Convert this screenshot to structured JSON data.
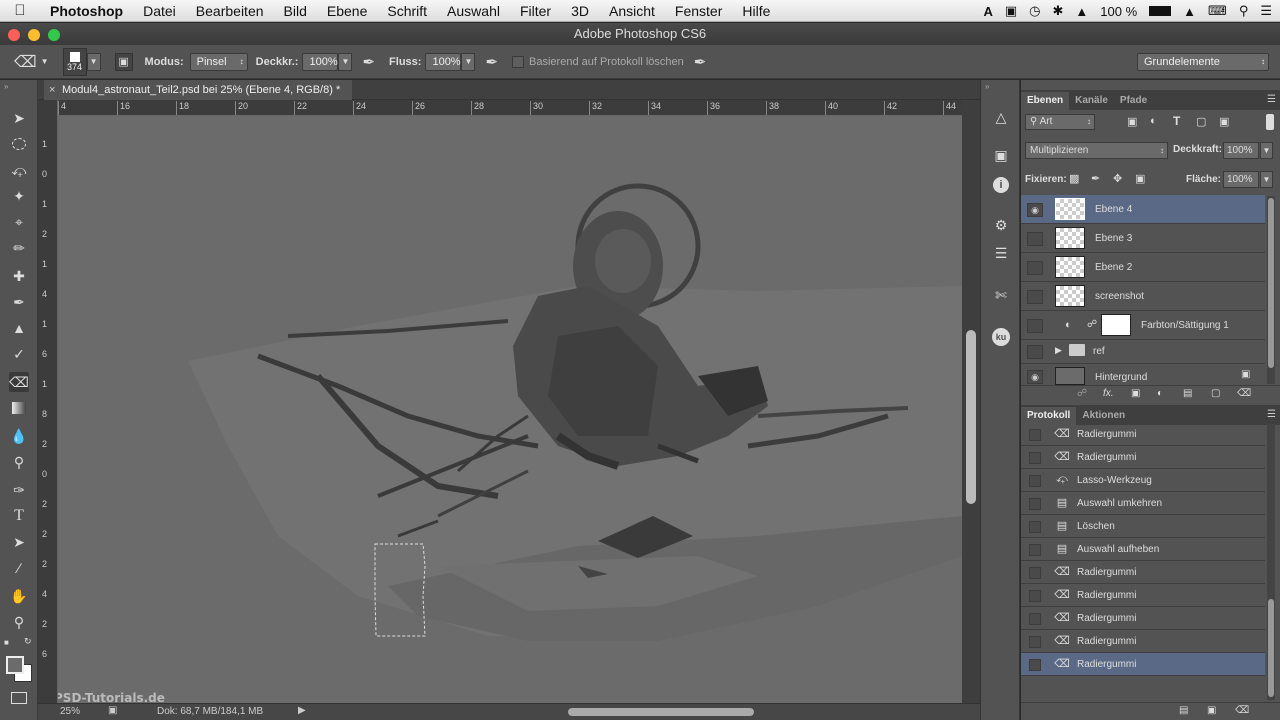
{
  "menubar": {
    "app": "Photoshop",
    "items": [
      "Datei",
      "Bearbeiten",
      "Bild",
      "Ebene",
      "Schrift",
      "Auswahl",
      "Filter",
      "3D",
      "Ansicht",
      "Fenster",
      "Hilfe"
    ],
    "battery": "100 %"
  },
  "window": {
    "title": "Adobe Photoshop CS6"
  },
  "options": {
    "brush_size": "374",
    "mode_label": "Modus:",
    "mode_value": "Pinsel",
    "opacity_label": "Deckkr.:",
    "opacity_value": "100%",
    "flow_label": "Fluss:",
    "flow_value": "100%",
    "history_checkbox": "Basierend auf Protokoll löschen",
    "workspace": "Grundelemente"
  },
  "document": {
    "tab_title": "Modul4_astronaut_Teil2.psd bei 25% (Ebene 4, RGB/8) *",
    "ruler_h": [
      "4",
      "16",
      "18",
      "20",
      "22",
      "24",
      "26",
      "28",
      "30",
      "32",
      "34",
      "36",
      "38",
      "40",
      "42",
      "44"
    ],
    "ruler_v": [
      "1",
      "0",
      "1",
      "2",
      "1",
      "4",
      "1",
      "6",
      "1",
      "8",
      "2",
      "0",
      "2",
      "2",
      "2",
      "4",
      "2",
      "6"
    ]
  },
  "status": {
    "zoom": "25%",
    "doc": "Dok: 68,7 MB/184,1 MB"
  },
  "watermark": "PSD-Tutorials.de",
  "layers_panel": {
    "tabs": [
      "Ebenen",
      "Kanäle",
      "Pfade"
    ],
    "filter": "Art",
    "blend_mode": "Multiplizieren",
    "opacity_label": "Deckkraft:",
    "opacity_value": "100%",
    "lock_label": "Fixieren:",
    "fill_label": "Fläche:",
    "fill_value": "100%",
    "layers": [
      {
        "name": "Ebene 4",
        "visible": true,
        "selected": true
      },
      {
        "name": "Ebene 3",
        "visible": false,
        "selected": false
      },
      {
        "name": "Ebene 2",
        "visible": false,
        "selected": false
      },
      {
        "name": "screenshot",
        "visible": false,
        "selected": false
      },
      {
        "name": "Farbton/Sättigung 1",
        "visible": false,
        "selected": false
      },
      {
        "name": "ref",
        "visible": false,
        "selected": false
      },
      {
        "name": "Hintergrund",
        "visible": true,
        "selected": false
      }
    ]
  },
  "history_panel": {
    "tabs": [
      "Protokoll",
      "Aktionen"
    ],
    "items": [
      {
        "name": "Radiergummi",
        "icon": "eraser-icon"
      },
      {
        "name": "Radiergummi",
        "icon": "eraser-icon"
      },
      {
        "name": "Lasso-Werkzeug",
        "icon": "lasso-icon"
      },
      {
        "name": "Auswahl umkehren",
        "icon": "document-icon"
      },
      {
        "name": "Löschen",
        "icon": "document-icon"
      },
      {
        "name": "Auswahl aufheben",
        "icon": "document-icon"
      },
      {
        "name": "Radiergummi",
        "icon": "eraser-icon"
      },
      {
        "name": "Radiergummi",
        "icon": "eraser-icon"
      },
      {
        "name": "Radiergummi",
        "icon": "eraser-icon"
      },
      {
        "name": "Radiergummi",
        "icon": "eraser-icon"
      },
      {
        "name": "Radiergummi",
        "icon": "eraser-icon"
      }
    ]
  },
  "colors": {
    "selection": "#5a6a86",
    "panel": "#535353",
    "canvas": "#6b6b6b"
  }
}
